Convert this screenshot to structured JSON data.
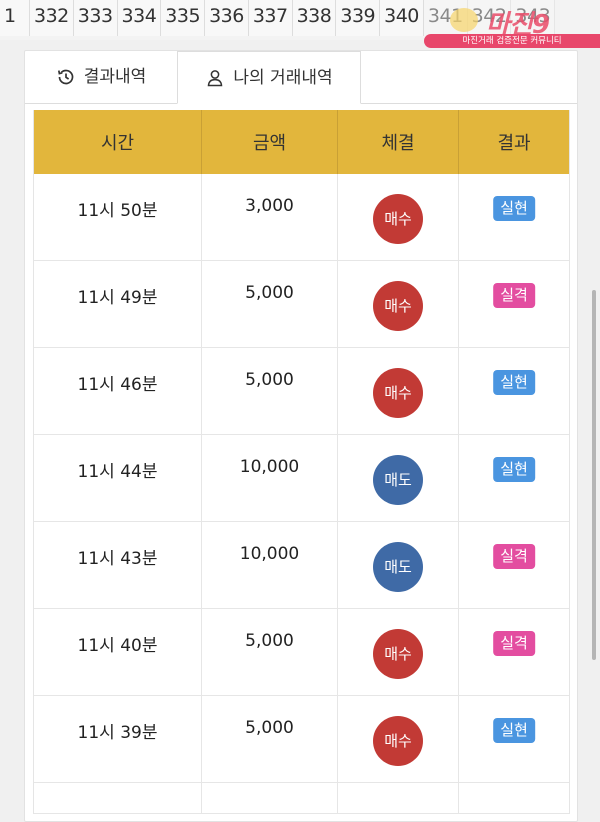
{
  "pagination": [
    "1",
    "332",
    "333",
    "334",
    "335",
    "336",
    "337",
    "338",
    "339",
    "340",
    "341",
    "342",
    "343"
  ],
  "watermark": {
    "logo_text": "마진",
    "logo_number": "9",
    "tagline": "마진거래 검증전문 커뮤니티"
  },
  "tabs": [
    {
      "label": "결과내역",
      "icon": "history-icon"
    },
    {
      "label": "나의 거래내역",
      "icon": "user-icon"
    }
  ],
  "table": {
    "headers": [
      "시간",
      "금액",
      "체결",
      "결과"
    ],
    "rows": [
      {
        "time": "11시 50분",
        "amount": "3,000",
        "trade": "매수",
        "trade_type": "buy",
        "result": "실현",
        "result_type": "real"
      },
      {
        "time": "11시 49분",
        "amount": "5,000",
        "trade": "매수",
        "trade_type": "buy",
        "result": "실격",
        "result_type": "fail"
      },
      {
        "time": "11시 46분",
        "amount": "5,000",
        "trade": "매수",
        "trade_type": "buy",
        "result": "실현",
        "result_type": "real"
      },
      {
        "time": "11시 44분",
        "amount": "10,000",
        "trade": "매도",
        "trade_type": "sell",
        "result": "실현",
        "result_type": "real"
      },
      {
        "time": "11시 43분",
        "amount": "10,000",
        "trade": "매도",
        "trade_type": "sell",
        "result": "실격",
        "result_type": "fail"
      },
      {
        "time": "11시 40분",
        "amount": "5,000",
        "trade": "매수",
        "trade_type": "buy",
        "result": "실격",
        "result_type": "fail"
      },
      {
        "time": "11시 39분",
        "amount": "5,000",
        "trade": "매수",
        "trade_type": "buy",
        "result": "실현",
        "result_type": "real"
      }
    ]
  },
  "colors": {
    "header_bg": "#e2b63c",
    "buy": "#c23a35",
    "sell": "#3f6aa6",
    "real": "#4a95e0",
    "fail": "#e34da0"
  }
}
